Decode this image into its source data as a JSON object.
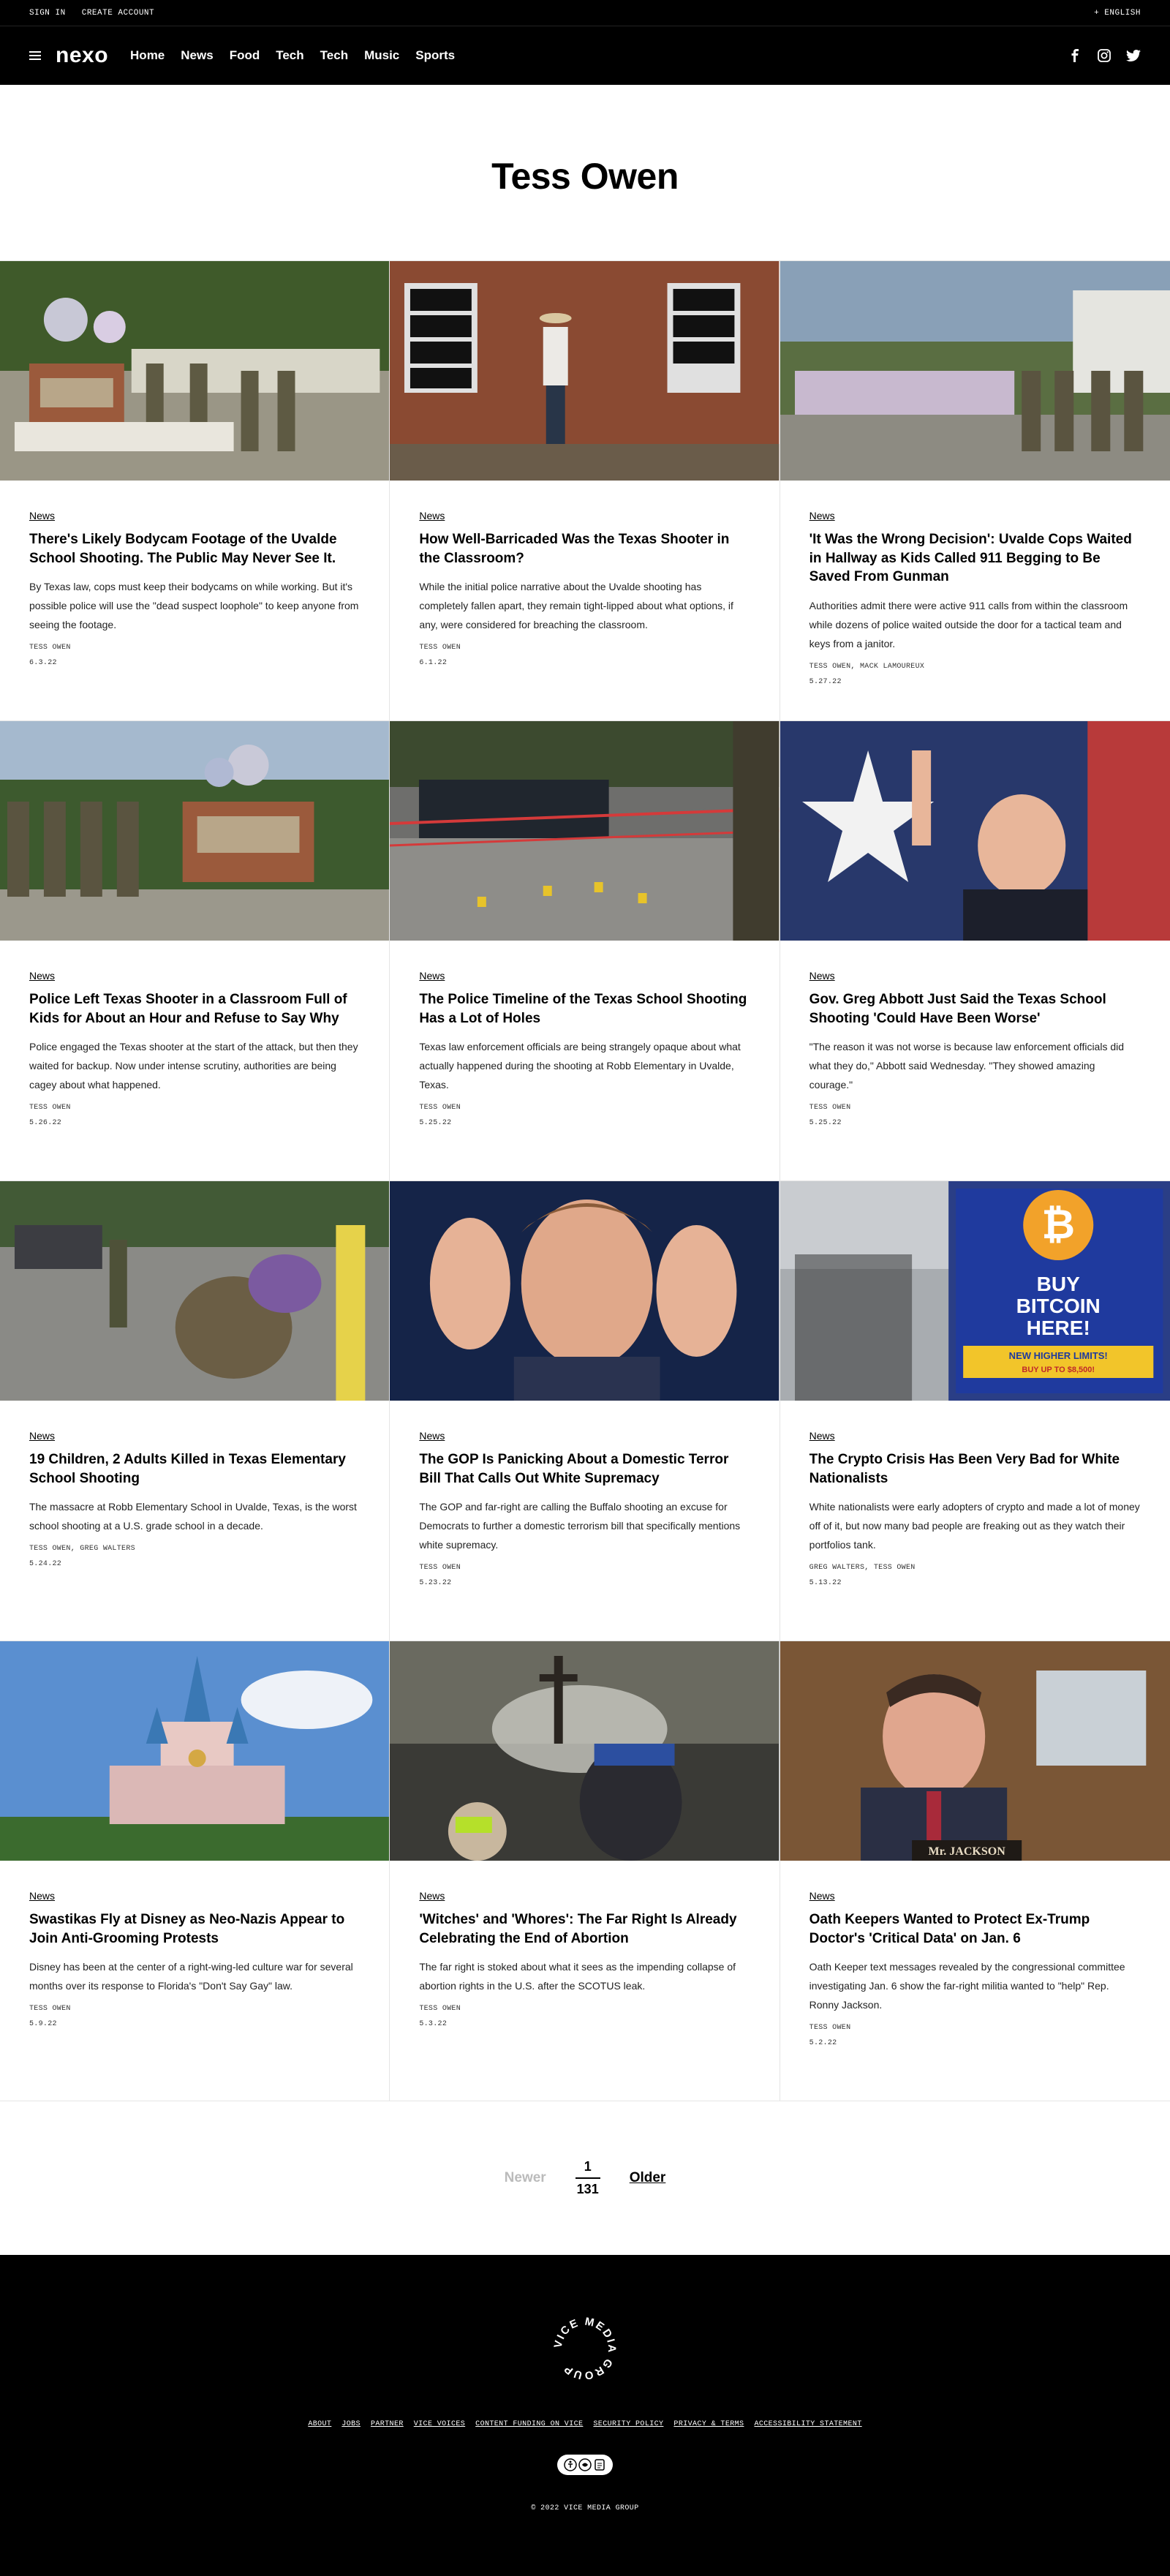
{
  "utility": {
    "sign_in": "SIGN IN",
    "create_account": "CREATE ACCOUNT",
    "language": "+ ENGLISH"
  },
  "nav": {
    "logo": "nexo",
    "links": [
      "Home",
      "News",
      "Food",
      "Tech",
      "Tech",
      "Music",
      "Sports"
    ],
    "social_icons": [
      "facebook-icon",
      "instagram-icon",
      "twitter-icon"
    ]
  },
  "page_title": "Tess Owen",
  "articles": [
    {
      "section": "News",
      "title": "There's Likely Bodycam Footage of the Uvalde School Shooting. The Public May Never See It.",
      "dek": "By Texas law, cops must keep their bodycams on while working. But it's possible police will use the \"dead suspect loophole\" to keep anyone from seeing the footage.",
      "byline": "TESS OWEN",
      "date": "6.3.22",
      "image": "uvalde-memorial-officers"
    },
    {
      "section": "News",
      "title": "How Well-Barricaded Was the Texas Shooter in the Classroom?",
      "dek": "While the initial police narrative about the Uvalde shooting has completely fallen apart, they remain tight-lipped about what options, if any, were considered for breaching the classroom.",
      "byline": "TESS OWEN",
      "date": "6.1.22",
      "image": "man-in-cowboy-hat-by-brick-wall"
    },
    {
      "section": "News",
      "title": "'It Was the Wrong Decision': Uvalde Cops Waited in Hallway as Kids Called 911 Begging to Be Saved From Gunman",
      "dek": "Authorities admit there were active 911 calls from within the classroom while dozens of police waited outside the door for a tactical team and keys from a janitor.",
      "byline": "TESS OWEN, MACK LAMOUREUX",
      "date": "5.27.22",
      "image": "officers-at-memorial"
    },
    {
      "section": "News",
      "title": "Police Left Texas Shooter in a Classroom Full of Kids for About an Hour and Refuse to Say Why",
      "dek": "Police engaged the Texas shooter at the start of the attack, but then they waited for backup. Now under intense scrutiny, authorities are being cagey about what happened.",
      "byline": "TESS OWEN",
      "date": "5.26.22",
      "image": "officers-at-school-sign"
    },
    {
      "section": "News",
      "title": "The Police Timeline of the Texas School Shooting Has a Lot of Holes",
      "dek": "Texas law enforcement officials are being strangely opaque about what actually happened during the shooting at Robb Elementary in Uvalde, Texas.",
      "byline": "TESS OWEN",
      "date": "5.25.22",
      "image": "crime-scene-markers"
    },
    {
      "section": "News",
      "title": "Gov. Greg Abbott Just Said the Texas School Shooting 'Could Have Been Worse'",
      "dek": "\"The reason it was not worse is because law enforcement officials did what they do,\" Abbott said Wednesday. \"They showed amazing courage.\"",
      "byline": "TESS OWEN",
      "date": "5.25.22",
      "image": "governor-speaking"
    },
    {
      "section": "News",
      "title": "19 Children, 2 Adults Killed in Texas Elementary School Shooting",
      "dek": "The massacre at Robb Elementary School in Uvalde, Texas, is the worst school shooting at a U.S. grade school in a decade.",
      "byline": "TESS OWEN, GREG WALTERS",
      "date": "5.24.22",
      "image": "people-grieving-on-curb"
    },
    {
      "section": "News",
      "title": "The GOP Is Panicking About a Domestic Terror Bill That Calls Out White Supremacy",
      "dek": "The GOP and far-right are calling the Buffalo shooting an excuse for Democrats to further a domestic terrorism bill that specifically mentions white supremacy.",
      "byline": "TESS OWEN",
      "date": "5.23.22",
      "image": "tv-host-gesturing"
    },
    {
      "section": "News",
      "title": "The Crypto Crisis Has Been Very Bad for White Nationalists",
      "dek": "White nationalists were early adopters of crypto and made a lot of money off of it, but now many bad people are freaking out as they watch their portfolios tank.",
      "byline": "GREG WALTERS, TESS OWEN",
      "date": "5.13.22",
      "image": "bitcoin-atm-sign",
      "image_text": {
        "line1": "BUY",
        "line2": "BITCOIN",
        "line3": "HERE!",
        "banner1": "NEW HIGHER LIMITS!",
        "banner2": "BUY UP TO $8,500!"
      }
    },
    {
      "section": "News",
      "title": "Swastikas Fly at Disney as Neo-Nazis Appear to Join Anti-Grooming Protests",
      "dek": "Disney has been at the center of a right-wing-led culture war for several months over its response to Florida's \"Don't Say Gay\" law.",
      "byline": "TESS OWEN",
      "date": "5.9.22",
      "image": "disney-castle"
    },
    {
      "section": "News",
      "title": "'Witches' and 'Whores': The Far Right Is Already Celebrating the End of Abortion",
      "dek": "The far right is stoked about what it sees as the impending collapse of abortion rights in the U.S. after the SCOTUS leak.",
      "byline": "TESS OWEN",
      "date": "5.3.22",
      "image": "protesters-with-cross"
    },
    {
      "section": "News",
      "title": "Oath Keepers Wanted to Protect Ex-Trump Doctor's 'Critical Data' on Jan. 6",
      "dek": "Oath Keeper text messages revealed by the congressional committee investigating Jan. 6 show the far-right militia wanted to \"help\" Rep. Ronny Jackson.",
      "byline": "TESS OWEN",
      "date": "5.2.22",
      "image": "congressman-at-hearing",
      "image_text": {
        "nameplate": "Mr. JACKSON"
      }
    }
  ],
  "pagination": {
    "newer": "Newer",
    "current": "1",
    "total": "131",
    "older": "Older"
  },
  "footer": {
    "logo_text": "VICE MEDIA GROUP",
    "links": [
      "ABOUT",
      "JOBS",
      "PARTNER",
      "VICE VOICES",
      "CONTENT FUNDING ON VICE",
      "SECURITY POLICY",
      "PRIVACY & TERMS",
      "ACCESSIBILITY STATEMENT"
    ],
    "copyright": "© 2022 VICE MEDIA GROUP"
  }
}
